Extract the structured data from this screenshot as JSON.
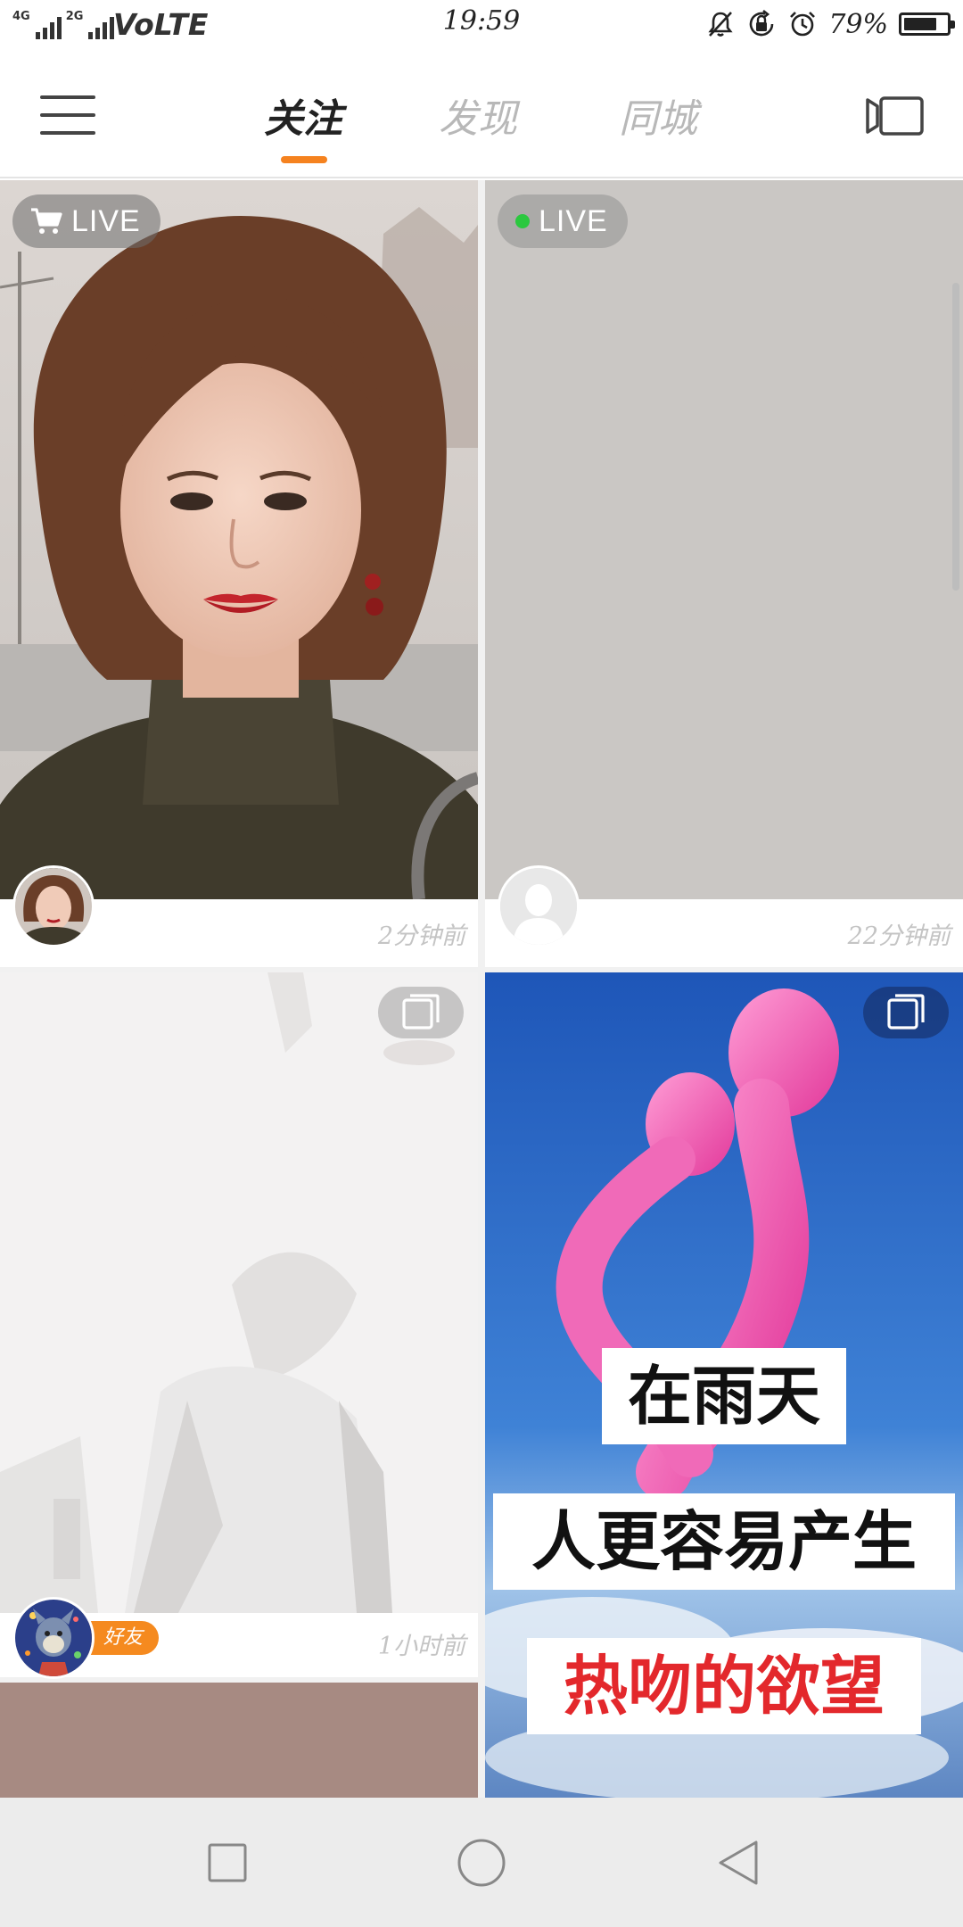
{
  "status_bar": {
    "signal_1_label": "4G",
    "signal_2_label": "2G",
    "volte_label": "VoLTE",
    "time": "19:59",
    "battery_percent_label": "79%",
    "battery_level": 0.79,
    "icons": [
      "mute-icon",
      "rotation-lock-icon",
      "alarm-icon",
      "battery-icon"
    ]
  },
  "top_nav": {
    "tabs": [
      {
        "label": "关注",
        "active": true
      },
      {
        "label": "发现",
        "active": false
      },
      {
        "label": "同城",
        "active": false
      }
    ],
    "accent_color": "#f5821f",
    "icons": [
      "menu-icon",
      "camera-icon"
    ]
  },
  "feed": {
    "cards": [
      {
        "type": "live",
        "badge_label": "LIVE",
        "badge_icon": "cart-icon",
        "time": "2分钟前"
      },
      {
        "type": "live",
        "badge_label": "LIVE",
        "badge_icon": "green-dot-icon",
        "time": "22分钟前"
      },
      {
        "type": "album",
        "badge_icon": "multi-image-icon",
        "friend_badge": "好友",
        "time": "1小时前"
      },
      {
        "type": "album",
        "badge_icon": "multi-image-icon",
        "captions": [
          "在雨天",
          "人更容易产生",
          "热吻的欲望"
        ]
      }
    ]
  },
  "bottom_nav": {
    "icons": [
      "recent-apps-icon",
      "home-icon",
      "back-icon"
    ]
  }
}
